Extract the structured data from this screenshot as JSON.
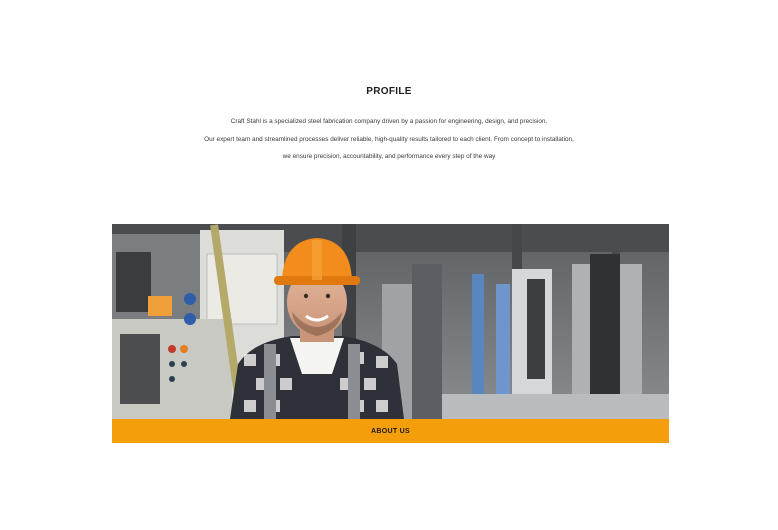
{
  "profile": {
    "title": "PROFILE",
    "lines": [
      "Craft Stahl is a specialized steel fabrication company driven by a passion for engineering, design, and precision.",
      "Our expert team and streamlined processes deliver reliable, high-quality results tailored to each client. From concept to installation,",
      "we ensure precision, accountability, and performance every step of the way"
    ]
  },
  "about": {
    "label": "ABOUT US",
    "color": "#f59e0b"
  }
}
